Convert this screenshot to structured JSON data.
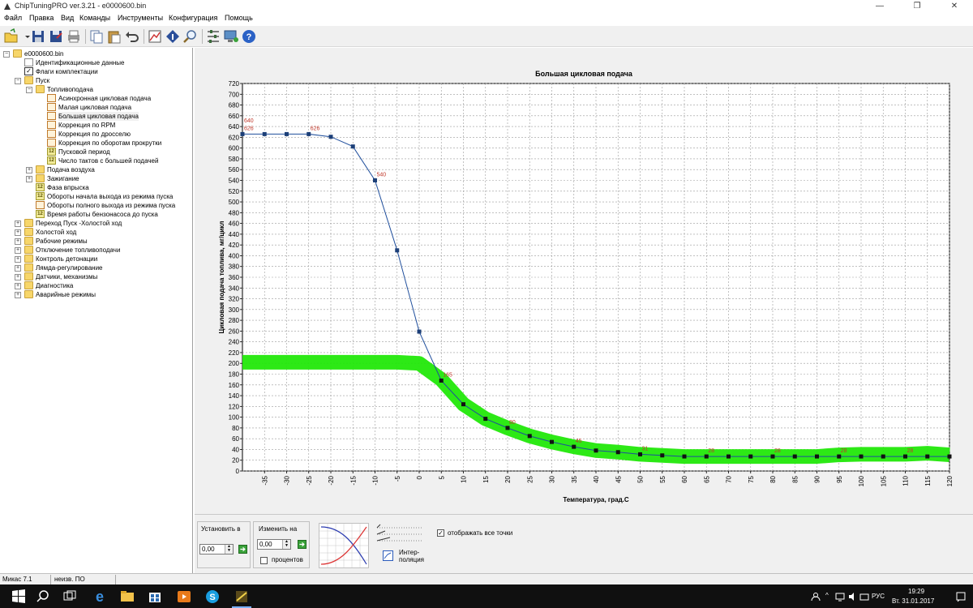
{
  "window": {
    "title": "ChipTuningPRO ver.3.21 - e0000600.bin",
    "minimize": "—",
    "maximize": "❐",
    "close": "✕"
  },
  "menu": [
    "Файл",
    "Правка",
    "Вид",
    "Команды",
    "Инструменты",
    "Конфигурация",
    "Помощь"
  ],
  "toolbar": [
    "open-icon",
    "dropdown-icon",
    "save-icon",
    "save-as-icon",
    "print-icon",
    "copy-icon",
    "paste-icon",
    "undo-icon",
    "graph-icon",
    "info-icon",
    "search-icon",
    "settings-icon",
    "monitor-icon",
    "help-icon"
  ],
  "tree": {
    "root": "e0000600.bin",
    "items": [
      {
        "label": "Идентификационные данные",
        "icon": "doc"
      },
      {
        "label": "Флаги комплектации",
        "icon": "check"
      },
      {
        "label": "Пуск",
        "icon": "folder-open"
      },
      {
        "label": "Топливоподача",
        "icon": "folder-open"
      },
      {
        "label": "Асинхронная цикловая подача",
        "icon": "graph"
      },
      {
        "label": "Малая цикловая подача",
        "icon": "graph"
      },
      {
        "label": "Большая цикловая подача",
        "icon": "graph"
      },
      {
        "label": "Коррекция по RPM",
        "icon": "graph"
      },
      {
        "label": "Коррекция по дросселю",
        "icon": "graph"
      },
      {
        "label": "Коррекция по оборотам прокрутки",
        "icon": "graph"
      },
      {
        "label": "Пусковой период",
        "icon": "number"
      },
      {
        "label": "Число тактов с большей подачей",
        "icon": "number"
      },
      {
        "label": "Подача воздуха",
        "icon": "folder"
      },
      {
        "label": "Зажигание",
        "icon": "folder"
      },
      {
        "label": "Фаза впрыска",
        "icon": "number"
      },
      {
        "label": "Обороты начала выхода из режима пуска",
        "icon": "number"
      },
      {
        "label": "Обороты полного выхода из режима пуска",
        "icon": "graph"
      },
      {
        "label": "Время работы бензонасоса до пуска",
        "icon": "number"
      },
      {
        "label": "Переход Пуск -Холостой ход",
        "icon": "folder"
      },
      {
        "label": "Холостой ход",
        "icon": "folder"
      },
      {
        "label": "Рабочие режимы",
        "icon": "folder"
      },
      {
        "label": "Отключение топливоподачи",
        "icon": "folder"
      },
      {
        "label": "Контроль детонации",
        "icon": "folder"
      },
      {
        "label": "Лямда-регулирование",
        "icon": "folder"
      },
      {
        "label": "Датчики, механизмы",
        "icon": "folder"
      },
      {
        "label": "Диагностика",
        "icon": "folder"
      },
      {
        "label": "Аварийные режимы",
        "icon": "folder"
      }
    ]
  },
  "chart_data": {
    "type": "line",
    "title": "Большая цикловая подача",
    "xlabel": "Температура, град.С",
    "ylabel": "Цикловая подача топлива, мг/цикл",
    "xlim": [
      -40,
      120
    ],
    "ylim": [
      0,
      720
    ],
    "y_ticks": [
      0,
      20,
      40,
      60,
      80,
      100,
      120,
      140,
      160,
      180,
      200,
      220,
      240,
      260,
      280,
      300,
      320,
      340,
      360,
      380,
      400,
      420,
      440,
      460,
      480,
      500,
      520,
      540,
      560,
      580,
      600,
      620,
      640,
      660,
      680,
      700,
      720
    ],
    "x_ticks": [
      -35,
      -30,
      -25,
      -20,
      -15,
      -10,
      -5,
      0,
      5,
      10,
      15,
      20,
      25,
      30,
      35,
      40,
      45,
      50,
      55,
      60,
      65,
      70,
      75,
      80,
      85,
      90,
      95,
      100,
      105,
      110,
      115,
      120
    ],
    "grid": true,
    "series": [
      {
        "name": "current",
        "color": "#1f4e9c",
        "x": [
          -40,
          -35,
          -30,
          -25,
          -20,
          -15,
          -10,
          -5,
          0,
          5,
          10,
          15,
          20,
          25,
          30,
          35,
          40,
          45,
          50,
          55,
          60,
          65,
          70,
          75,
          80,
          85,
          90,
          95,
          100,
          105,
          110,
          115,
          120
        ],
        "y": [
          626,
          626,
          626,
          626,
          621,
          603,
          540,
          410,
          259,
          168,
          124,
          97,
          80,
          65,
          54,
          45,
          38,
          35,
          31,
          29,
          27,
          27,
          27,
          27,
          27,
          27,
          27,
          27,
          27,
          27,
          27,
          27,
          27
        ]
      }
    ],
    "reference_band": {
      "color": "#22e80a",
      "x": [
        -40,
        -35,
        -30,
        -25,
        -20,
        -15,
        -10,
        -5,
        0,
        5,
        10,
        15,
        20,
        25,
        30,
        35,
        40,
        45,
        50,
        55,
        60,
        65,
        70,
        75,
        80,
        85,
        90,
        95,
        100,
        105,
        110,
        115,
        120
      ],
      "y": [
        202,
        202,
        202,
        202,
        202,
        202,
        202,
        202,
        200,
        170,
        124,
        97,
        80,
        65,
        54,
        45,
        38,
        35,
        31,
        29,
        27,
        27,
        27,
        27,
        27,
        27,
        27,
        30,
        31,
        31,
        31,
        33,
        30
      ]
    },
    "point_labels": [
      {
        "x": -40,
        "y": 626,
        "text": "626"
      },
      {
        "x": -25,
        "y": 626,
        "text": "626"
      },
      {
        "x": -40,
        "y": 640,
        "text": "640"
      },
      {
        "x": -10,
        "y": 540,
        "text": "540"
      },
      {
        "x": 5,
        "y": 168,
        "text": "165"
      },
      {
        "x": 20,
        "y": 80,
        "text": "80"
      },
      {
        "x": 35,
        "y": 45,
        "text": "45"
      },
      {
        "x": 50,
        "y": 31,
        "text": "31"
      },
      {
        "x": 65,
        "y": 27,
        "text": "28"
      },
      {
        "x": 80,
        "y": 27,
        "text": "28"
      },
      {
        "x": 95,
        "y": 27,
        "text": "28"
      },
      {
        "x": 110,
        "y": 27,
        "text": "28"
      }
    ]
  },
  "panel": {
    "set_label": "Установить в",
    "set_value": "0,00",
    "change_label": "Изменить на",
    "change_value": "0,00",
    "percent_label": "процентов",
    "interp_label_1": "Интер-",
    "interp_label_2": "поляция",
    "show_points_label": "отображать все точки",
    "show_points_checked": true
  },
  "status": {
    "cell1": "Микас 7.1",
    "cell2": "неизв. ПО"
  },
  "taskbar": {
    "lang": "РУС",
    "time": "19:29",
    "date": "Вт. 31.01.2017"
  }
}
